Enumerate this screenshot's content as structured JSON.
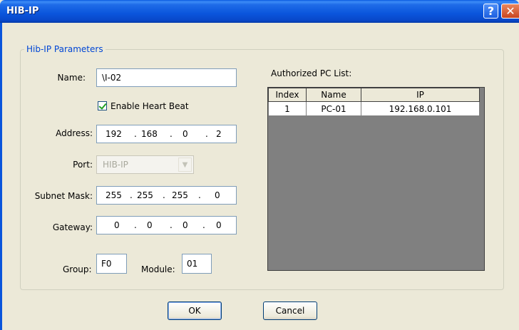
{
  "window": {
    "title": "HIB-IP",
    "help_glyph": "?",
    "close_glyph": "✕"
  },
  "group": {
    "legend": "Hib-IP Parameters"
  },
  "form": {
    "name_label": "Name:",
    "name_value": "\\I-02",
    "heartbeat_label": "Enable Heart Beat",
    "heartbeat_checked": true,
    "address_label": "Address:",
    "address": [
      "192",
      "168",
      "0",
      "2"
    ],
    "port_label": "Port:",
    "port_value": "HIB-IP",
    "subnet_label": "Subnet Mask:",
    "subnet": [
      "255",
      "255",
      "255",
      "0"
    ],
    "gateway_label": "Gateway:",
    "gateway": [
      "0",
      "0",
      "0",
      "0"
    ],
    "group_label": "Group:",
    "group_value": "F0",
    "module_label": "Module:",
    "module_value": "01",
    "ip_separator": "."
  },
  "pc_list": {
    "title": "Authorized PC List:",
    "columns": [
      "Index",
      "Name",
      "IP"
    ],
    "rows": [
      [
        "1",
        "PC-01",
        "192.168.0.101"
      ]
    ]
  },
  "buttons": {
    "ok": "OK",
    "cancel": "Cancel"
  },
  "colors": {
    "titlebar": "#0a55dc",
    "legend": "#0046d5",
    "background": "#ece9d8",
    "grid_bg": "#808080"
  }
}
